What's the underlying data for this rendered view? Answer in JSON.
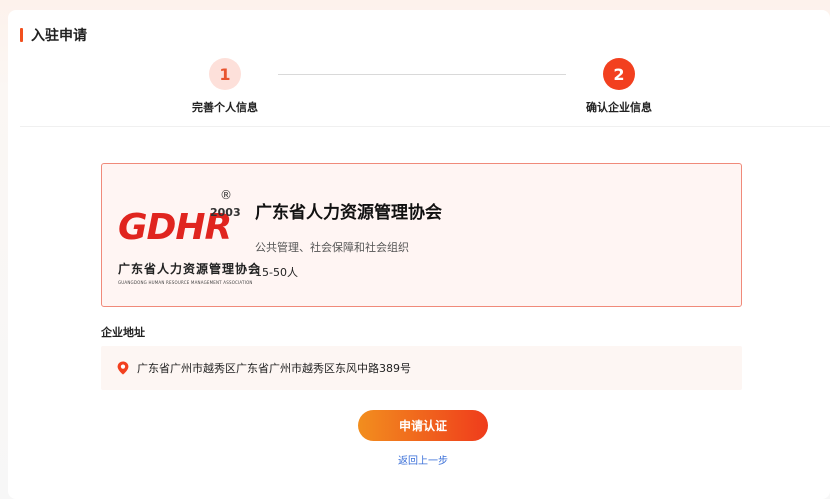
{
  "page": {
    "section_title": "入驻申请"
  },
  "steps": [
    {
      "number": "1",
      "label": "完善个人信息",
      "state": "done"
    },
    {
      "number": "2",
      "label": "确认企业信息",
      "state": "active"
    }
  ],
  "company": {
    "logo": {
      "letters": "GDHR",
      "year": "2003",
      "registered_mark": "®",
      "name_cn": "广东省人力资源管理协会",
      "name_en": "GUANGDONG HUMAN RESOURCE MANAGEMENT ASSOCIATION"
    },
    "name": "广东省人力资源管理协会",
    "industry": "公共管理、社会保障和社会组织",
    "size": "15-50人"
  },
  "address": {
    "label": "企业地址",
    "icon": "location-pin-icon",
    "text": "广东省广州市越秀区广东省广州市越秀区东风中路389号"
  },
  "actions": {
    "apply_label": "申请认证",
    "back_label": "返回上一步"
  },
  "colors": {
    "accent": "#f2401f",
    "accent_light": "#fde0da",
    "link": "#3a6fd8",
    "button_gradient_start": "#f28e1e",
    "button_gradient_end": "#ef3c1c"
  }
}
